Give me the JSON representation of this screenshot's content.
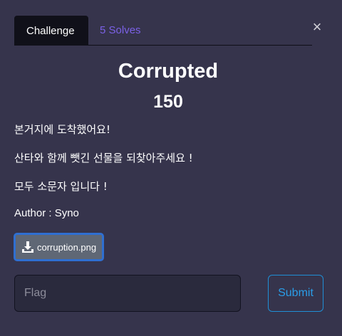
{
  "tabs": [
    {
      "label": "Challenge",
      "active": true
    },
    {
      "label": "5 Solves",
      "active": false
    }
  ],
  "close_symbol": "×",
  "challenge": {
    "name": "Corrupted",
    "value": "150",
    "description": [
      "본거지에 도착했어요!",
      "산타와 함께 뺏긴 선물을 되찾아주세요 !",
      "모두 소문자 입니다 !"
    ],
    "author": "Author : Syno"
  },
  "file": {
    "icon": "download-icon",
    "name": "corruption.png"
  },
  "flag_input": {
    "placeholder": "Flag",
    "value": ""
  },
  "submit": {
    "label": "Submit"
  },
  "colors": {
    "background": "#36344c",
    "active_tab": "#101019",
    "solves_tab_text": "#7b61e6",
    "file_button": "#5f6775",
    "file_button_border": "#2f6fd1",
    "submit_accent": "#2a9de8"
  }
}
